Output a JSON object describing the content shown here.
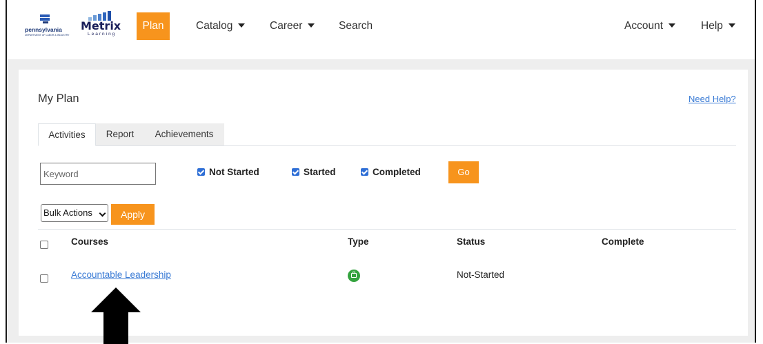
{
  "logos": {
    "pa_word": "pennsylvania",
    "pa_sub": "DEPARTMENT OF LABOR & INDUSTRY",
    "metrix_word": "Metrix",
    "metrix_sub": "Learning"
  },
  "nav": {
    "plan": "Plan",
    "catalog": "Catalog",
    "career": "Career",
    "search": "Search",
    "account": "Account",
    "help": "Help"
  },
  "page": {
    "title": "My Plan",
    "need_help": "Need Help?"
  },
  "tabs": [
    {
      "label": "Activities",
      "active": true
    },
    {
      "label": "Report",
      "active": false
    },
    {
      "label": "Achievements",
      "active": false
    }
  ],
  "filters": {
    "keyword_placeholder": "Keyword",
    "not_started": "Not Started",
    "started": "Started",
    "completed": "Completed",
    "go": "Go"
  },
  "bulk": {
    "selected": "Bulk Actions",
    "apply": "Apply"
  },
  "table": {
    "headers": [
      "Courses",
      "Type",
      "Status",
      "Complete"
    ],
    "rows": [
      {
        "course": "Accountable Leadership",
        "type_icon": "briefcase-icon",
        "status": "Not-Started",
        "complete": ""
      }
    ]
  },
  "colors": {
    "accent": "#f7941d",
    "link": "#3a7bd5",
    "type_icon": "#34a33f",
    "checkbox": "#2f6fd6"
  }
}
